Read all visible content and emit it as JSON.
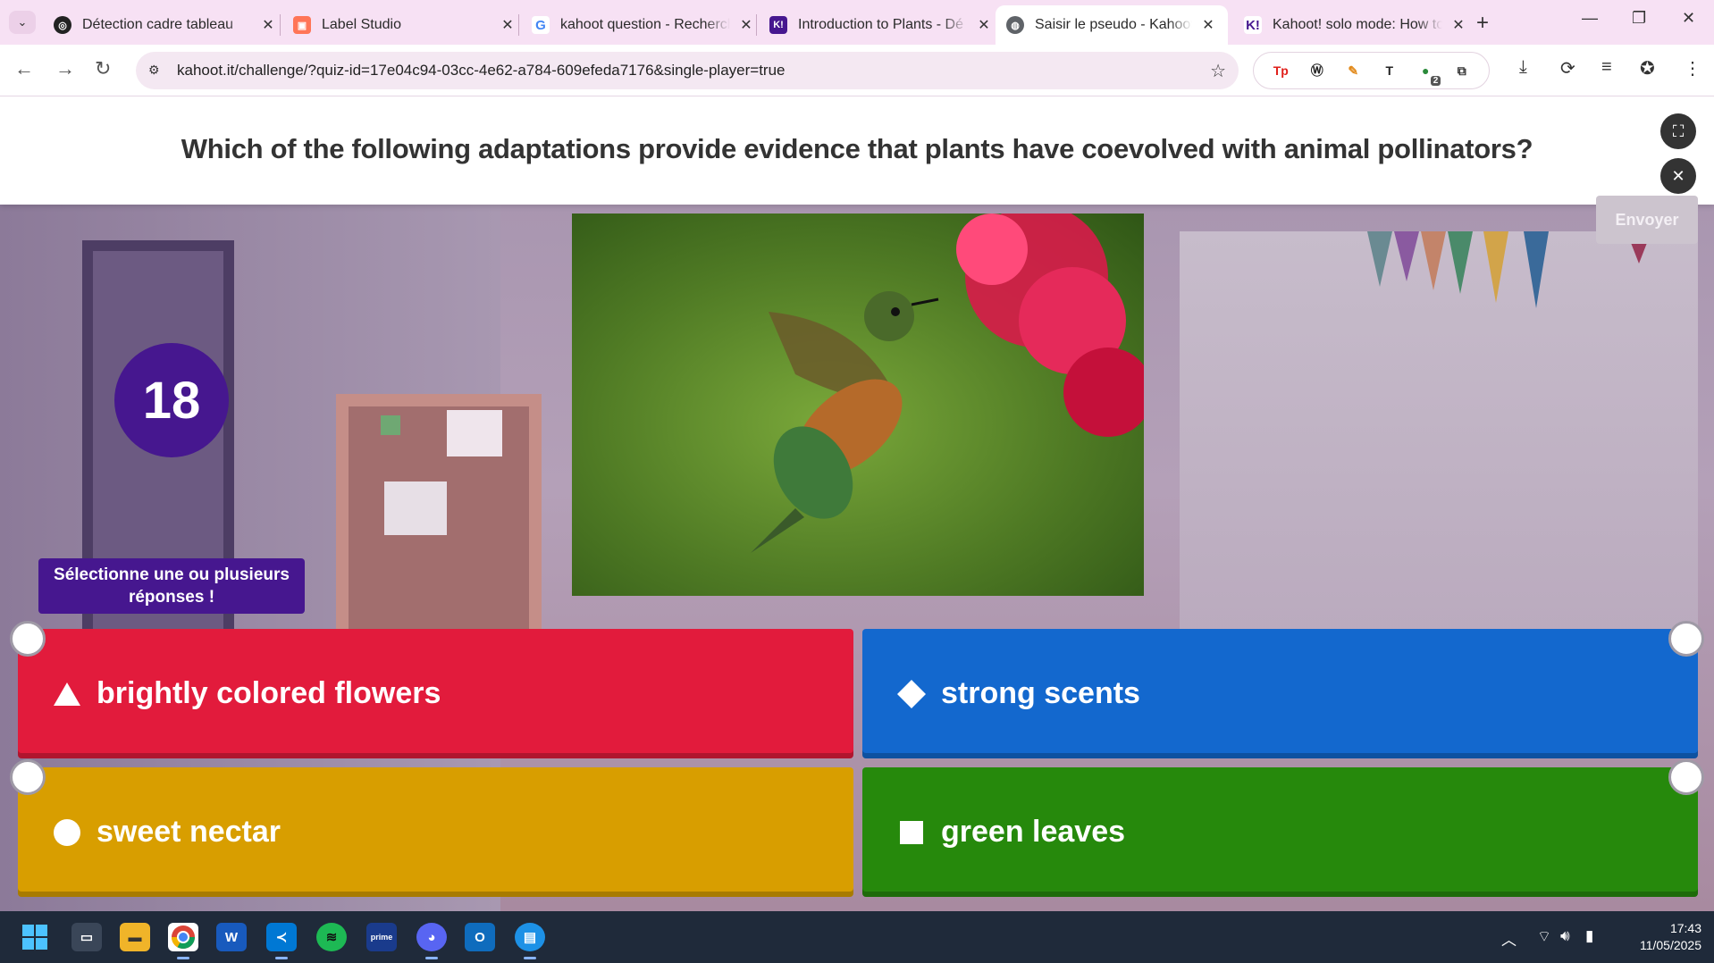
{
  "browser": {
    "tabs": [
      {
        "title": "Détection cadre tableau",
        "favicon": "openai-icon",
        "active": false
      },
      {
        "title": "Label Studio",
        "favicon": "label-studio-icon",
        "active": false
      },
      {
        "title": "kahoot question - Recherche",
        "favicon": "google-icon",
        "active": false
      },
      {
        "title": "Introduction to Plants - Dé",
        "favicon": "kahoot-icon",
        "active": false
      },
      {
        "title": "Saisir le pseudo - Kahoot!",
        "favicon": "globe-icon",
        "active": true
      },
      {
        "title": "Kahoot! solo mode: How to",
        "favicon": "kahoot-icon",
        "active": false
      }
    ],
    "url": "kahoot.it/challenge/?quiz-id=17e04c94-03cc-4e62-a784-609efeda7176&single-player=true"
  },
  "quiz": {
    "question": "Which of the following adaptations provide evidence that plants have coevolved with animal pollinators?",
    "timer": "18",
    "submit_label": "Envoyer",
    "hint": "Sélectionne une ou plusieurs réponses !",
    "image_alt": "hummingbird-feeding-on-red-flower",
    "answers": [
      {
        "label": "brightly colored flowers",
        "shape": "triangle",
        "color": "#e21b3c"
      },
      {
        "label": "strong scents",
        "shape": "diamond",
        "color": "#1368ce"
      },
      {
        "label": "sweet nectar",
        "shape": "circle",
        "color": "#d89e00"
      },
      {
        "label": "green leaves",
        "shape": "square",
        "color": "#26890c"
      }
    ]
  },
  "taskbar": {
    "time": "17:43",
    "date": "11/05/2025",
    "apps": [
      "windows-start",
      "task-view",
      "file-explorer",
      "chrome",
      "word",
      "vscode",
      "spotify",
      "prime-video",
      "discord",
      "outlook",
      "docker"
    ]
  },
  "extensions": {
    "badge_count": "2"
  }
}
